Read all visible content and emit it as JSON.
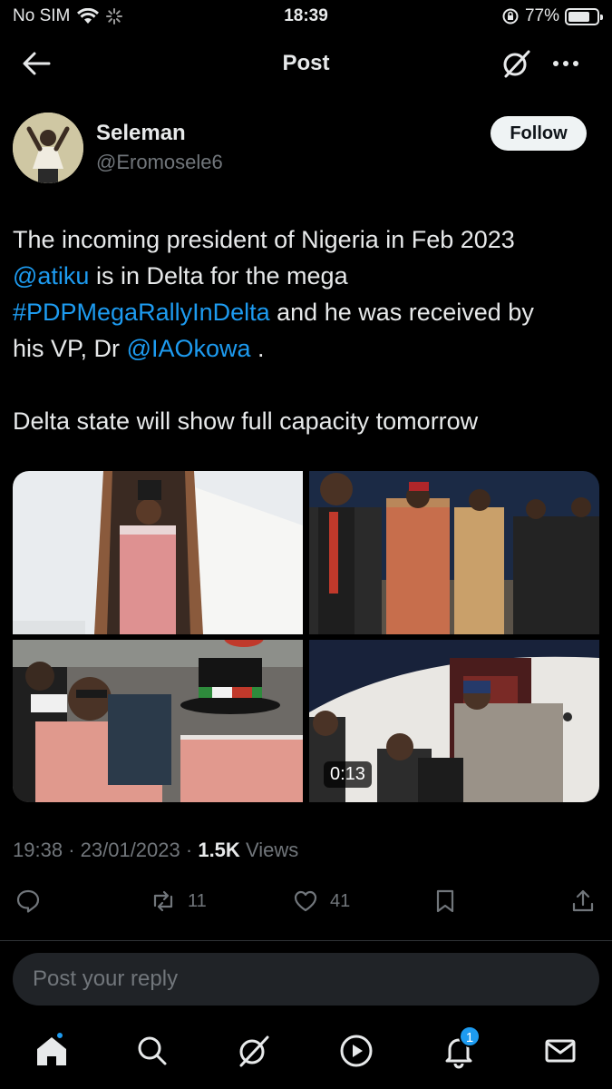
{
  "status_bar": {
    "carrier": "No SIM",
    "time": "18:39",
    "battery": "77%",
    "battery_level": 0.77
  },
  "header": {
    "title": "Post"
  },
  "author": {
    "name": "Seleman",
    "handle": "@Eromosele6",
    "follow_label": "Follow"
  },
  "post": {
    "lines": [
      [
        {
          "text": "The incoming president of Nigeria in Feb 2023",
          "link": false
        }
      ],
      [
        {
          "text": "@atiku",
          "link": true
        },
        {
          "text": " is in Delta for the mega",
          "link": false
        }
      ],
      [
        {
          "text": "#PDPMegaRallyInDelta",
          "link": true
        },
        {
          "text": "  and he was received by",
          "link": false
        }
      ],
      [
        {
          "text": "his VP, Dr ",
          "link": false
        },
        {
          "text": "@IAOkowa",
          "link": true
        },
        {
          "text": " .",
          "link": false
        }
      ],
      [],
      [
        {
          "text": "Delta state will show full capacity tomorrow",
          "link": false
        }
      ]
    ]
  },
  "media": {
    "video_duration": "0:13"
  },
  "meta": {
    "time": "19:38",
    "date": "23/01/2023",
    "views_count": "1.5K",
    "views_label": "Views"
  },
  "actions": {
    "replies": "",
    "reposts": "11",
    "likes": "41"
  },
  "reply": {
    "placeholder": "Post your reply"
  },
  "tabbar": {
    "notifications_badge": "1"
  },
  "colors": {
    "accent": "#1d9bf0",
    "background": "#000000",
    "secondary_text": "#71767b"
  }
}
